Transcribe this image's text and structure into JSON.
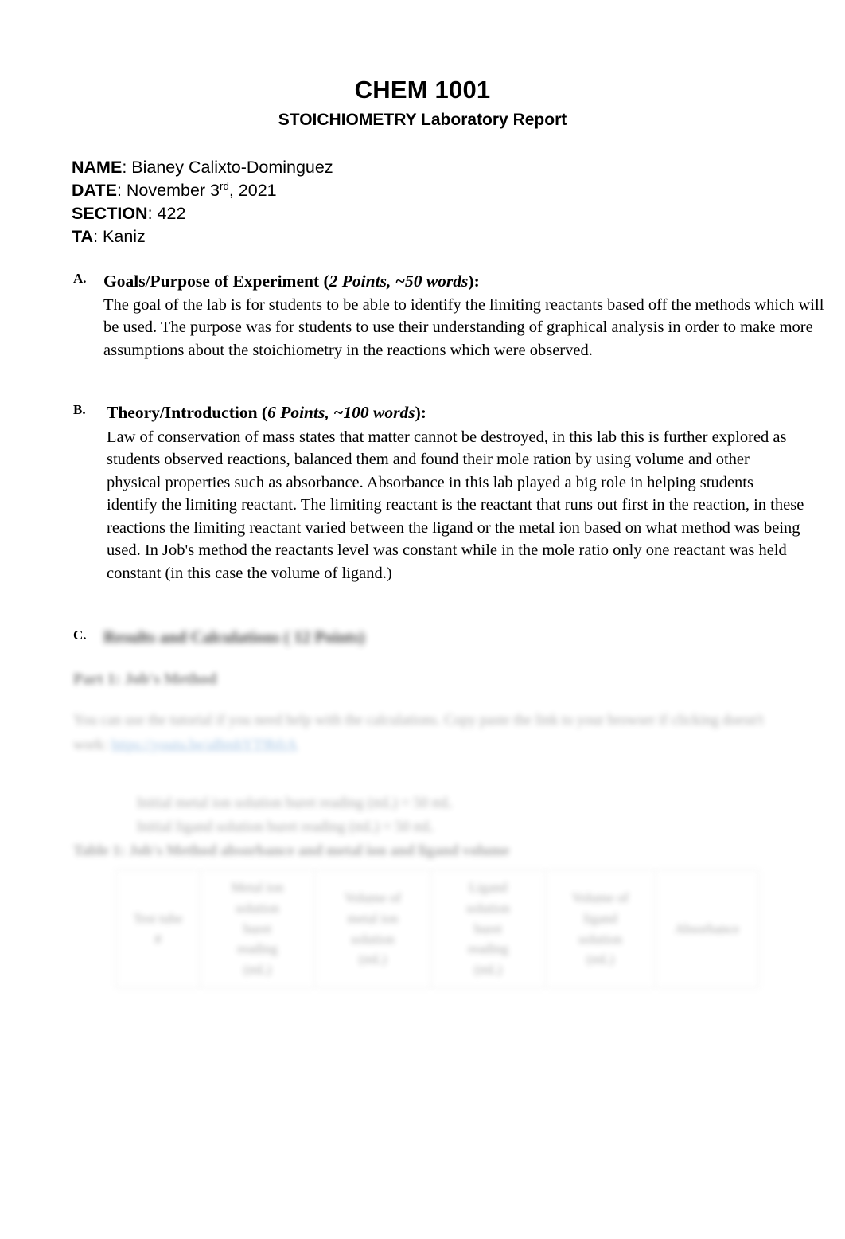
{
  "document": {
    "title": "CHEM 1001",
    "subtitle": "STOICHIOMETRY Laboratory Report"
  },
  "meta": {
    "name_label": "NAME",
    "name_value": ": Bianey Calixto-Dominguez",
    "date_label": "DATE",
    "date_value_pre": ": November 3",
    "date_ordinal": "rd",
    "date_value_post": ", 2021",
    "section_label": "SECTION",
    "section_value": ": 422",
    "ta_label": "TA",
    "ta_value": ": Kaniz"
  },
  "sections": {
    "a": {
      "marker": "A.",
      "heading_main": "Goals/Purpose of Experiment (",
      "heading_points": "2 Points, ~50 words",
      "heading_tail": "):",
      "body": "The goal of the lab is for students to be able to identify the limiting reactants based off the methods which will be used. The purpose was for students to use their understanding of graphical analysis in order to make more assumptions about the stoichiometry in the reactions which were observed."
    },
    "b": {
      "marker": "B.",
      "heading_main": "Theory/Introduction (",
      "heading_points": "6 Points, ~100 words",
      "heading_tail": "):",
      "body": "Law of conservation of mass states that matter cannot be destroyed, in this lab this is further explored as students observed reactions, balanced them and found their mole ration by using volume and other physical properties such as absorbance. Absorbance in this lab played a big role in helping students identify the limiting reactant. The limiting reactant is the reactant that runs out first in the reaction, in these reactions the limiting reactant varied between the ligand or the metal ion based on what method was being used. In Job's method the reactants level was constant while in the mole ratio only one reactant was held constant (in this case the volume of ligand.)"
    },
    "c": {
      "marker": "C.",
      "heading": "Results and Calculations (     12 Points)",
      "subheading": "Part 1: Job's Method",
      "paragraph_pre": "You can use the tutorial if you need help with the calculations. Copy paste the link to your browser if clicking doesn't work: ",
      "paragraph_link": "https://youtu.be/aBmhYT9bfrA",
      "indent_line_1": "Initial metal ion solution buret reading (mL)  =  50 mL",
      "indent_line_2": "Initial ligand solution buret reading (mL)  =  50 mL",
      "table_caption": "Table 1: Job's Method absorbance and metal ion and ligand volume"
    }
  },
  "table": {
    "columns": [
      {
        "lines": [
          "Test tube",
          "#"
        ]
      },
      {
        "lines": [
          "Metal ion",
          "solution",
          "buret",
          "reading",
          "(mL)"
        ]
      },
      {
        "lines": [
          "Volume of",
          "metal ion",
          "solution",
          "(mL)"
        ]
      },
      {
        "lines": [
          "Ligand",
          "solution",
          "buret",
          "reading",
          "(mL)"
        ]
      },
      {
        "lines": [
          "Volume of",
          "ligand",
          "solution",
          "(mL)"
        ]
      },
      {
        "lines": [
          "Absorbance"
        ]
      }
    ]
  },
  "colors": {
    "page_background": "#ffffff",
    "text": "#000000",
    "hyperlink": "#3b7fc4",
    "table_border": "#d6d6d6"
  }
}
